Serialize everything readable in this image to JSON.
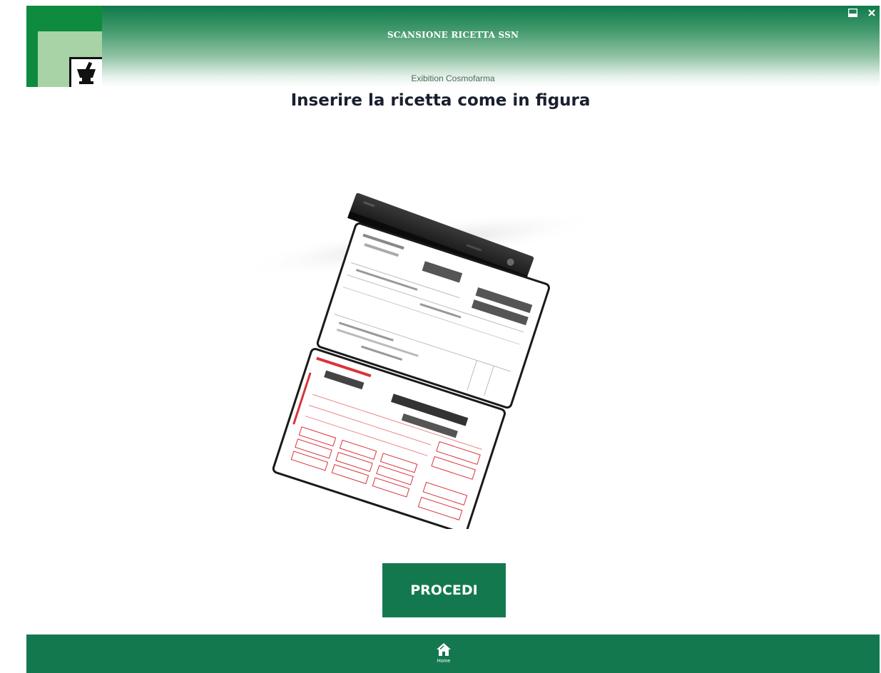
{
  "header": {
    "title": "SCANSIONE RICETTA SSN",
    "subtitle": "Exibition Cosmofarma"
  },
  "window_controls": {
    "minimize_icon": "minimize-icon",
    "close_icon": "close-icon"
  },
  "main": {
    "instruction": "Inserire la ricetta come in figura",
    "procedi_label": "PROCEDI"
  },
  "footer": {
    "home_label": "Home",
    "home_icon": "home-icon"
  },
  "colors": {
    "brand_green": "#14784e",
    "logo_green": "#0e8b3e",
    "prescription_red": "#d9343a"
  }
}
